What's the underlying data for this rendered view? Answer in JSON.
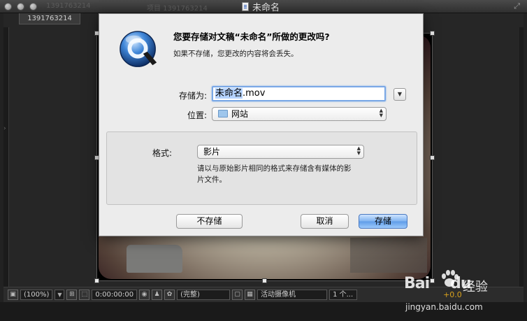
{
  "window": {
    "title": "未命名",
    "ghost_tabs": [
      "1391763214",
      "项目 1391763214"
    ]
  },
  "panel": {
    "comp_tab": "1391763214"
  },
  "dialog": {
    "heading": "您要存储对文稿“未命名”所做的更改吗?",
    "subtext": "如果不存储，您更改的内容将会丢失。",
    "save_as_label": "存储为:",
    "filename_selected": "未命名",
    "filename_ext": ".mov",
    "location_label": "位置:",
    "location_value": "网站",
    "format_label": "格式:",
    "format_value": "影片",
    "format_desc_line1": "请以与原始影片相同的格式来存储含有媒体的影",
    "format_desc_line2": "片文件。",
    "dont_save_label": "不存储",
    "cancel_label": "取消",
    "save_label": "存储",
    "accent": "#5f9ce8"
  },
  "toolbar": {
    "zoom": "(100%)",
    "timecode": "0:00:00:00",
    "resolution": "(完整)",
    "camera": "活动摄像机",
    "views": "1 个...",
    "exposure": "+0.0",
    "exposure_color": "#d9a21c"
  },
  "watermark": {
    "logo": "Bai",
    "logo_tail": "du",
    "cn": "经验",
    "url": "jingyan.baidu.com"
  }
}
